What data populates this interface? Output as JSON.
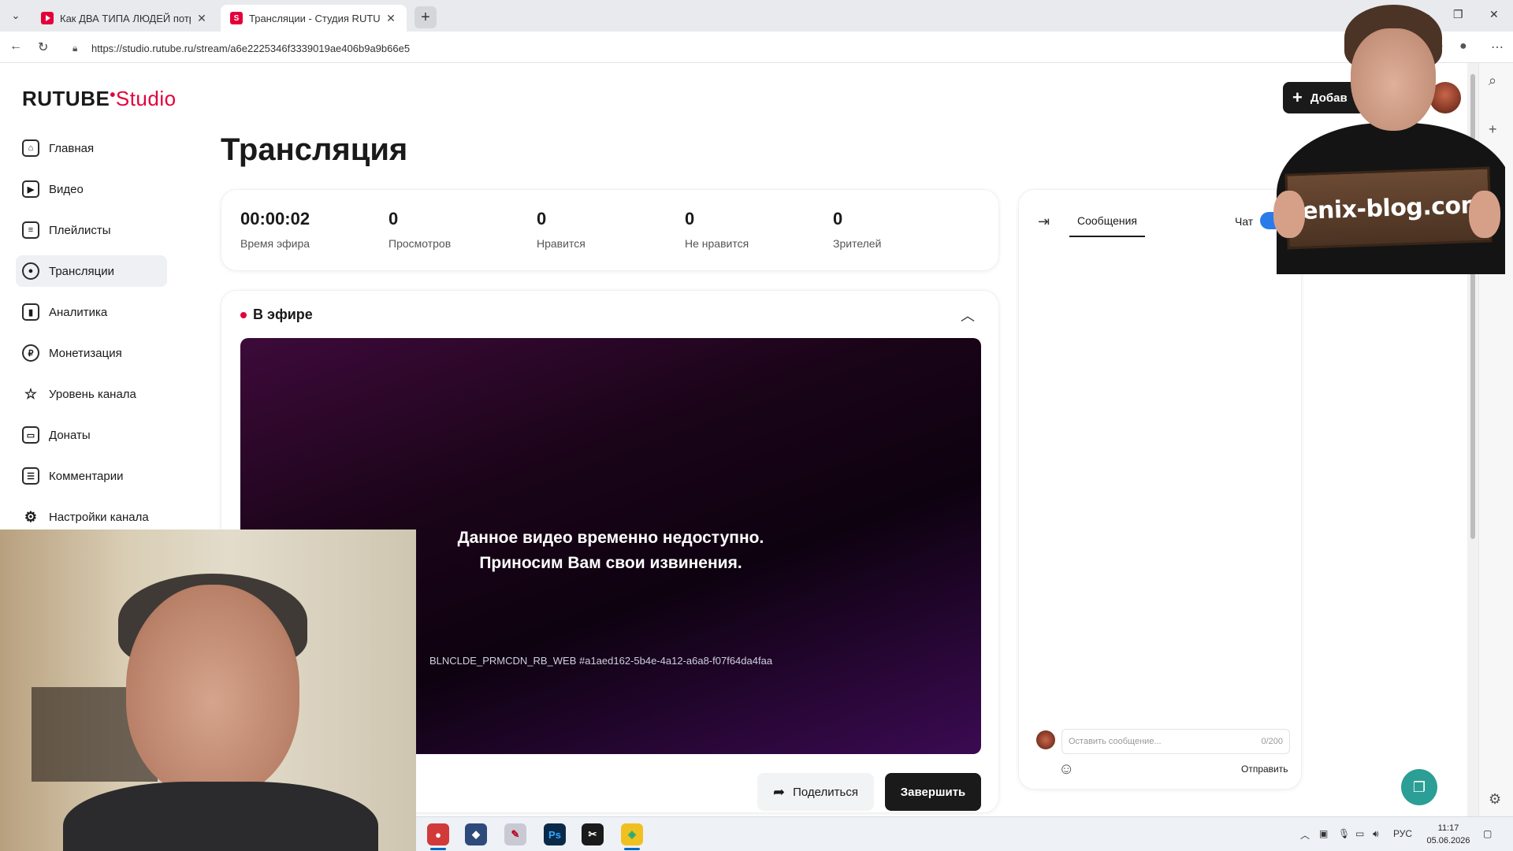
{
  "browser": {
    "tabs": [
      {
        "title": "Как ДВА ТИПА ЛЮДЕЙ потратят",
        "favicon": "youtube-icon",
        "active": false
      },
      {
        "title": "Трансляции - Студия RUTUBE",
        "favicon": "rutube-icon",
        "active": true
      }
    ],
    "url": "https://studio.rutube.ru/stream/a6e2225346f3339019ae406b9a9b66e5"
  },
  "logo": {
    "brand": "RUTUBE",
    "product": "Studio"
  },
  "sidebar": {
    "items": [
      {
        "label": "Главная",
        "icon": "home-icon"
      },
      {
        "label": "Видео",
        "icon": "video-icon"
      },
      {
        "label": "Плейлисты",
        "icon": "playlist-icon"
      },
      {
        "label": "Трансляции",
        "icon": "broadcast-icon",
        "active": true
      },
      {
        "label": "Аналитика",
        "icon": "analytics-icon"
      },
      {
        "label": "Монетизация",
        "icon": "ruble-icon"
      },
      {
        "label": "Уровень канала",
        "icon": "star-icon"
      },
      {
        "label": "Донаты",
        "icon": "wallet-icon"
      },
      {
        "label": "Комментарии",
        "icon": "comment-icon"
      },
      {
        "label": "Настройки канала",
        "icon": "gear-icon"
      }
    ]
  },
  "header": {
    "add_label": "Добав"
  },
  "page": {
    "title": "Трансляция"
  },
  "stats": [
    {
      "value": "00:00:02",
      "label": "Время эфира"
    },
    {
      "value": "0",
      "label": "Просмотров"
    },
    {
      "value": "0",
      "label": "Нравится"
    },
    {
      "value": "0",
      "label": "Не нравится"
    },
    {
      "value": "0",
      "label": "Зрителей"
    }
  ],
  "live": {
    "status_label": "В эфире",
    "video_message_line1": "Данное видео временно недоступно.",
    "video_message_line2": "Приносим Вам свои извинения.",
    "error_code": "BLNCLDE_PRMCDN_RB_WEB #a1aed162-5b4e-4a12-a6a8-f07f64da4faa",
    "share_label": "Поделиться",
    "end_label": "Завершить"
  },
  "chat": {
    "tab_label": "Сообщения",
    "toggle_label": "Чат",
    "toggle_on": true,
    "input_placeholder": "Оставить сообщение...",
    "counter": "0/200",
    "send_label": "Отправить"
  },
  "overlay": {
    "sign_text": "fenix-blog.com"
  },
  "taskbar": {
    "lang": "РУС",
    "time": "11:17",
    "date": "05.06.2026"
  },
  "colors": {
    "brand_red": "#e3003a",
    "toggle_blue": "#2a7bea",
    "support_teal": "#2b9e95",
    "dark": "#1a1a1a"
  }
}
